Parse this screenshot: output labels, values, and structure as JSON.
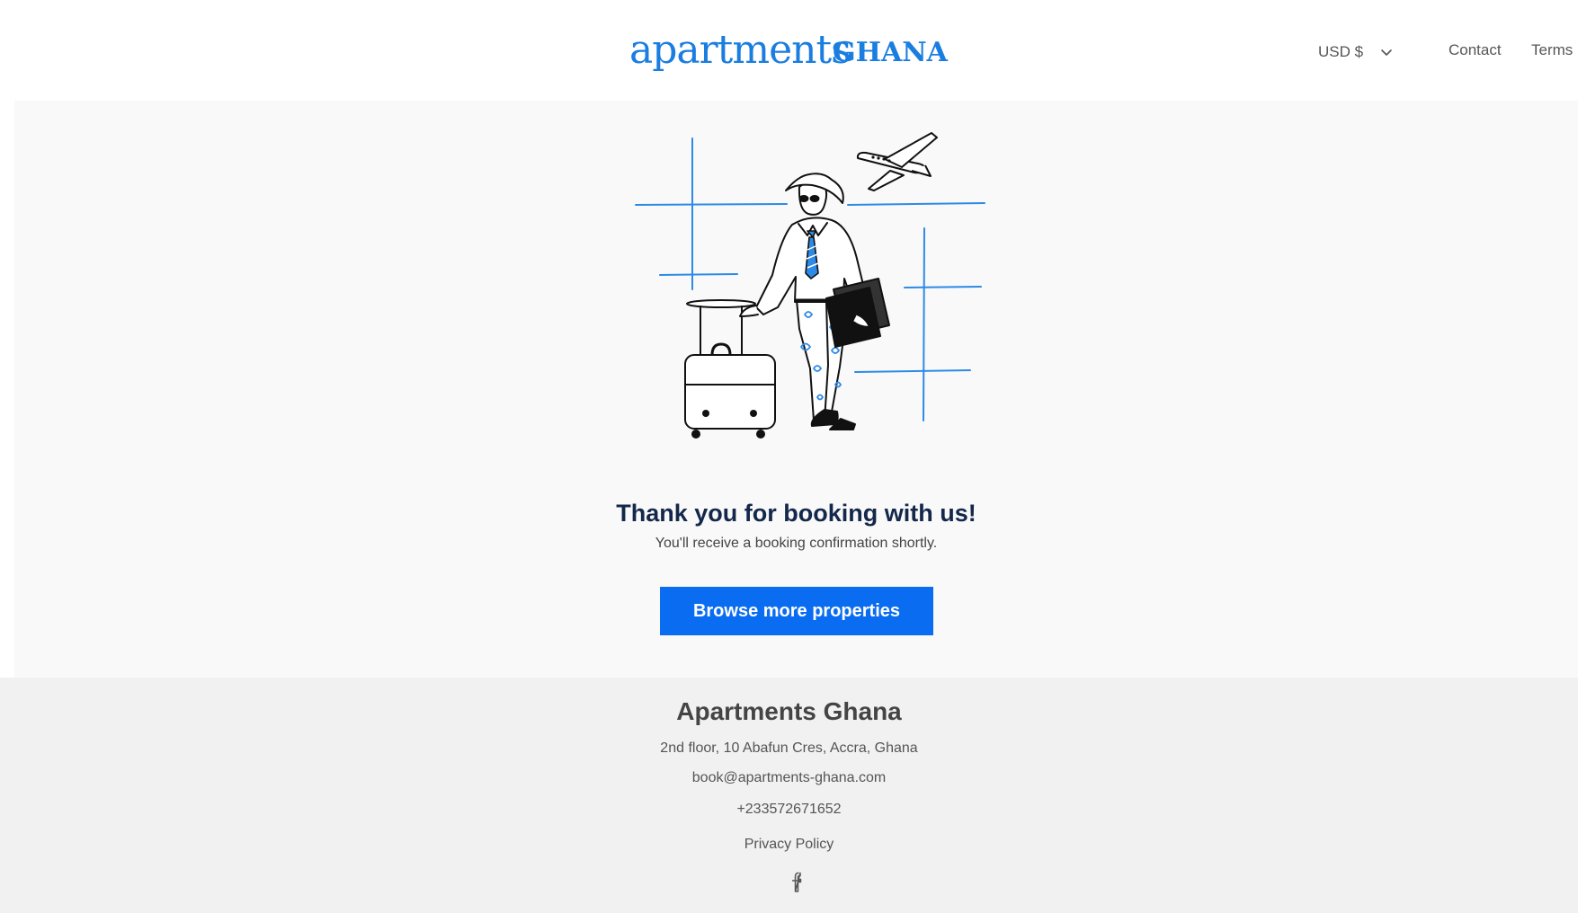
{
  "header": {
    "logo": {
      "word1": "apartments",
      "word2": "GHANA"
    },
    "currency": {
      "label": "USD $",
      "icon": "chevron-down-icon"
    },
    "nav": {
      "contact": "Contact",
      "terms": "Terms"
    }
  },
  "main": {
    "illustration": "traveler-with-suitcase-illustration",
    "title": "Thank you for booking with us!",
    "subtitle": "You'll receive a booking confirmation shortly.",
    "cta_label": "Browse more properties"
  },
  "footer": {
    "company": "Apartments Ghana",
    "address": "2nd floor, 10 Abafun Cres, Accra, Ghana",
    "email": "book@apartments-ghana.com",
    "phone": "+233572671652",
    "privacy": "Privacy Policy",
    "social_icon": "facebook-icon"
  },
  "colors": {
    "brand": "#1a7de0",
    "button": "#0a6cf0",
    "title": "#14284b",
    "main_bg": "#f9f9f9",
    "footer_bg": "#f1f1f1"
  }
}
